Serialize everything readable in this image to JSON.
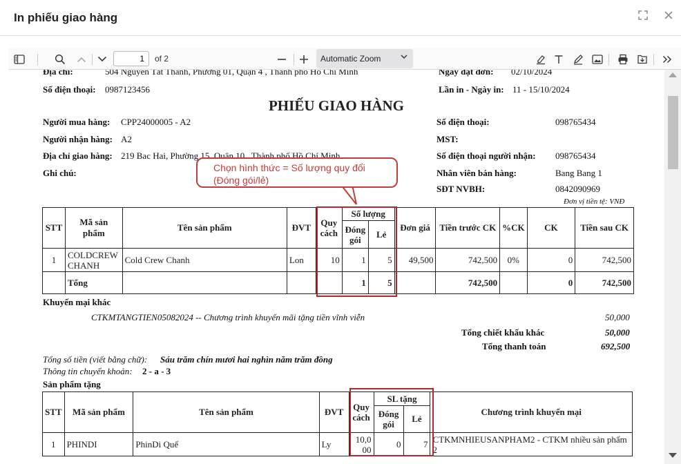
{
  "dialog": {
    "title": "In phiếu giao hàng"
  },
  "toolbar": {
    "page_current": "1",
    "page_of": "of 2",
    "zoom": "Automatic Zoom"
  },
  "header": {
    "address_label": "Địa chỉ:",
    "address_value": "504 Nguyễn Tất Thành, Phường 01, Quận 4 , Thành phố Hồ Chí Minh",
    "order_date_label": "Ngày đặt đơn:",
    "order_date_value": "02/10/2024",
    "phone_label": "Số điện thoại:",
    "phone_value": "0987123456",
    "print_label": "Lần in - Ngày in:",
    "print_value": "11 - 15/10/2024"
  },
  "doc_title": "PHIẾU GIAO HÀNG",
  "info": {
    "buyer_label": "Người mua hàng:",
    "buyer_value": "CPP24000005 - A2",
    "receiver_label": "Người nhận hàng:",
    "receiver_value": "A2",
    "ship_addr_label": "Địa chỉ giao hàng:",
    "ship_addr_value": "219 Bac Hai, Phường 15, Quận 10 , Thành phố Hồ Chí Minh",
    "note_label": "Ghi chú:",
    "r_phone_label": "Số điện thoại:",
    "r_phone_value": "098765434",
    "mst_label": "MST:",
    "recv_phone_label": "Số điện thoại người nhận:",
    "recv_phone_value": "098765434",
    "sales_label": "Nhân viên bán hàng:",
    "sales_value": "Bang Bang 1",
    "sales_phone_label": "SĐT NVBH:",
    "sales_phone_value": "0842090969",
    "currency": "Đơn vị tiền tệ: VNĐ"
  },
  "callout": "Chọn hình thức = Số lượng quy đổi (Đóng gói/lẻ)",
  "main_table": {
    "headers": {
      "stt": "STT",
      "code": "Mã sản phẩm",
      "name": "Tên sản phẩm",
      "unit": "ĐVT",
      "spec": "Quy cách",
      "qty_group": "Số lượng",
      "pack": "Đóng gói",
      "loose": "Lẻ",
      "price": "Đơn giá",
      "before_ck": "Tiền trước CK",
      "pct_ck": "%CK",
      "ck": "CK",
      "after_ck": "Tiền sau CK"
    },
    "row": {
      "stt": "1",
      "code": "COLDCREW CHANH",
      "name": "Cold Crew Chanh",
      "unit": "Lon",
      "spec": "10",
      "pack": "1",
      "loose": "5",
      "price": "49,500",
      "before_ck": "742,500",
      "pct_ck": "0%",
      "ck": "0",
      "after_ck": "742,500"
    },
    "total": {
      "label": "Tổng",
      "pack": "1",
      "loose": "5",
      "before_ck": "742,500",
      "ck": "0",
      "after_ck": "742,500"
    }
  },
  "promo": {
    "heading": "Khuyến mại khác",
    "line": "CTKMTANGTIEN05082024 -- Chương trình khuyến mãi tặng tiền vĩnh viễn",
    "line_value": "50,000",
    "other_discount_label": "Tổng chiết khấu khác",
    "other_discount_value": "50,000",
    "payment_label": "Tổng thanh toán",
    "payment_value": "692,500"
  },
  "words": {
    "label": "Tổng số tiền (viết bằng chữ):",
    "value": "Sáu trăm chín mươi hai nghìn năm trăm đồng"
  },
  "transfer": {
    "label": "Thông tin chuyển khoản:",
    "value": "2 - a - 3"
  },
  "gift": {
    "heading": "Sản phẩm tặng",
    "headers": {
      "stt": "STT",
      "code": "Mã sản phẩm",
      "name": "Tên sản phẩm",
      "unit": "ĐVT",
      "spec": "Quy cách",
      "qty_group": "SL tặng",
      "pack": "Đóng gói",
      "loose": "Lẻ",
      "program": "Chương trình khuyến mại"
    },
    "row": {
      "stt": "1",
      "code": "PHINDI",
      "name": "PhinDi Quế",
      "unit": "Ly",
      "spec": "10,000",
      "pack": "0",
      "loose": "7",
      "program": "CTKMNHIEUSANPHAM2 - CTKM nhiều sản phẩm 2"
    }
  }
}
